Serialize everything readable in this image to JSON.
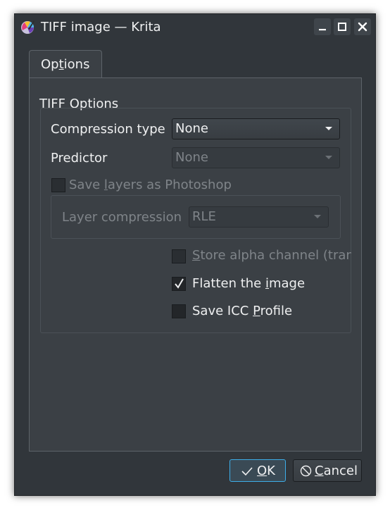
{
  "window": {
    "title": "TIFF image — Krita",
    "app_icon": "krita-logo-icon",
    "controls": [
      "minimize-icon",
      "maximize-icon",
      "close-icon"
    ]
  },
  "tabs": [
    {
      "label": "Options",
      "selected": true
    }
  ],
  "tiff_options": {
    "group_title": "TIFF Options",
    "compression_type": {
      "label": "Compression type",
      "value": "None"
    },
    "predictor": {
      "label": "Predictor",
      "value": "None",
      "enabled": false
    },
    "save_layers": {
      "label": "Save layers as Photoshop",
      "checked": false,
      "enabled": false
    },
    "layer_compression": {
      "label": "Layer compression",
      "value": "RLE",
      "enabled": false
    },
    "store_alpha": {
      "label": "Store alpha channel (tran",
      "checked": false,
      "enabled": false
    },
    "flatten_image": {
      "label": "Flatten the image",
      "checked": true
    },
    "save_icc": {
      "label": "Save ICC Profile",
      "checked": false
    }
  },
  "buttons": {
    "ok": {
      "label": "OK",
      "icon": "checkmark-icon"
    },
    "cancel": {
      "label": "Cancel",
      "icon": "cancel-circle-icon"
    }
  },
  "colors": {
    "window_bg": "#31363b",
    "panel_bg": "#3b4045",
    "text": "#eff0f1",
    "disabled_text": "#7f8489",
    "focus_accent": "#3daee9"
  }
}
